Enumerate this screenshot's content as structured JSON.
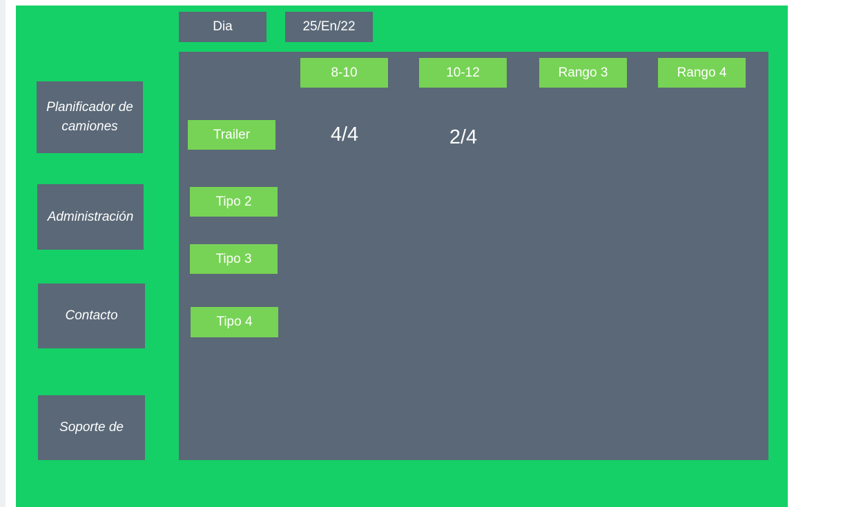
{
  "header": {
    "day_label": "Dia",
    "date_value": "25/En/22"
  },
  "sidebar": {
    "items": [
      {
        "label": "Planificador de camiones"
      },
      {
        "label": "Administración"
      },
      {
        "label": "Contacto"
      },
      {
        "label": "Soporte de"
      }
    ]
  },
  "schedule": {
    "ranges": [
      "8-10",
      "10-12",
      "Rango 3",
      "Rango 4"
    ],
    "types": [
      "Trailer",
      "Tipo 2",
      "Tipo 3",
      "Tipo 4"
    ],
    "cells": [
      {
        "type": "Trailer",
        "range": "8-10",
        "value": "4/4"
      },
      {
        "type": "Trailer",
        "range": "10-12",
        "value": "2/4"
      }
    ]
  },
  "colors": {
    "background": "#14d066",
    "panel": "#5a6877",
    "chip": "#77d355",
    "text": "#ffffff"
  }
}
